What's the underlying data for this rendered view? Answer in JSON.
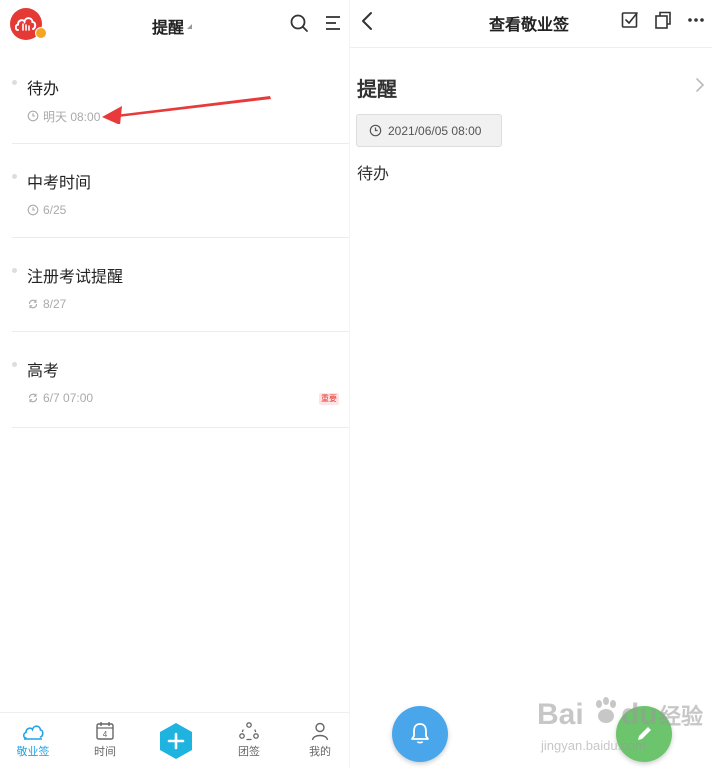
{
  "left": {
    "header": {
      "title": "提醒"
    },
    "items": [
      {
        "title": "待办",
        "time": "明天 08:00",
        "icon": "clock-icon"
      },
      {
        "title": "中考时间",
        "time": "6/25",
        "icon": "clock-icon"
      },
      {
        "title": "注册考试提醒",
        "time": "8/27",
        "icon": "repeat-icon"
      },
      {
        "title": "高考",
        "time": "6/7 07:00",
        "icon": "repeat-icon",
        "tag": "重要"
      }
    ],
    "tabs": [
      {
        "label": "敬业签",
        "icon": "cloud-icon",
        "active": true
      },
      {
        "label": "时间",
        "icon": "calendar-icon",
        "active": false,
        "day": "4"
      },
      {
        "label": "团签",
        "icon": "group-icon",
        "active": false
      },
      {
        "label": "我的",
        "icon": "person-icon",
        "active": false
      }
    ]
  },
  "right": {
    "header": {
      "title": "查看敬业签"
    },
    "note": {
      "heading": "提醒",
      "datetime": "2021/06/05 08:00",
      "body": "待办"
    }
  },
  "watermark": {
    "line1": "Bai",
    "line2": "du",
    "line3": "经验",
    "url": "jingyan.baidu.com"
  },
  "colors": {
    "accent": "#1fa3e6",
    "brand_red": "#e53935",
    "fab_blue": "#4aa6ea",
    "fab_green": "#6cc46c",
    "arrow_red": "#e83a3a"
  }
}
